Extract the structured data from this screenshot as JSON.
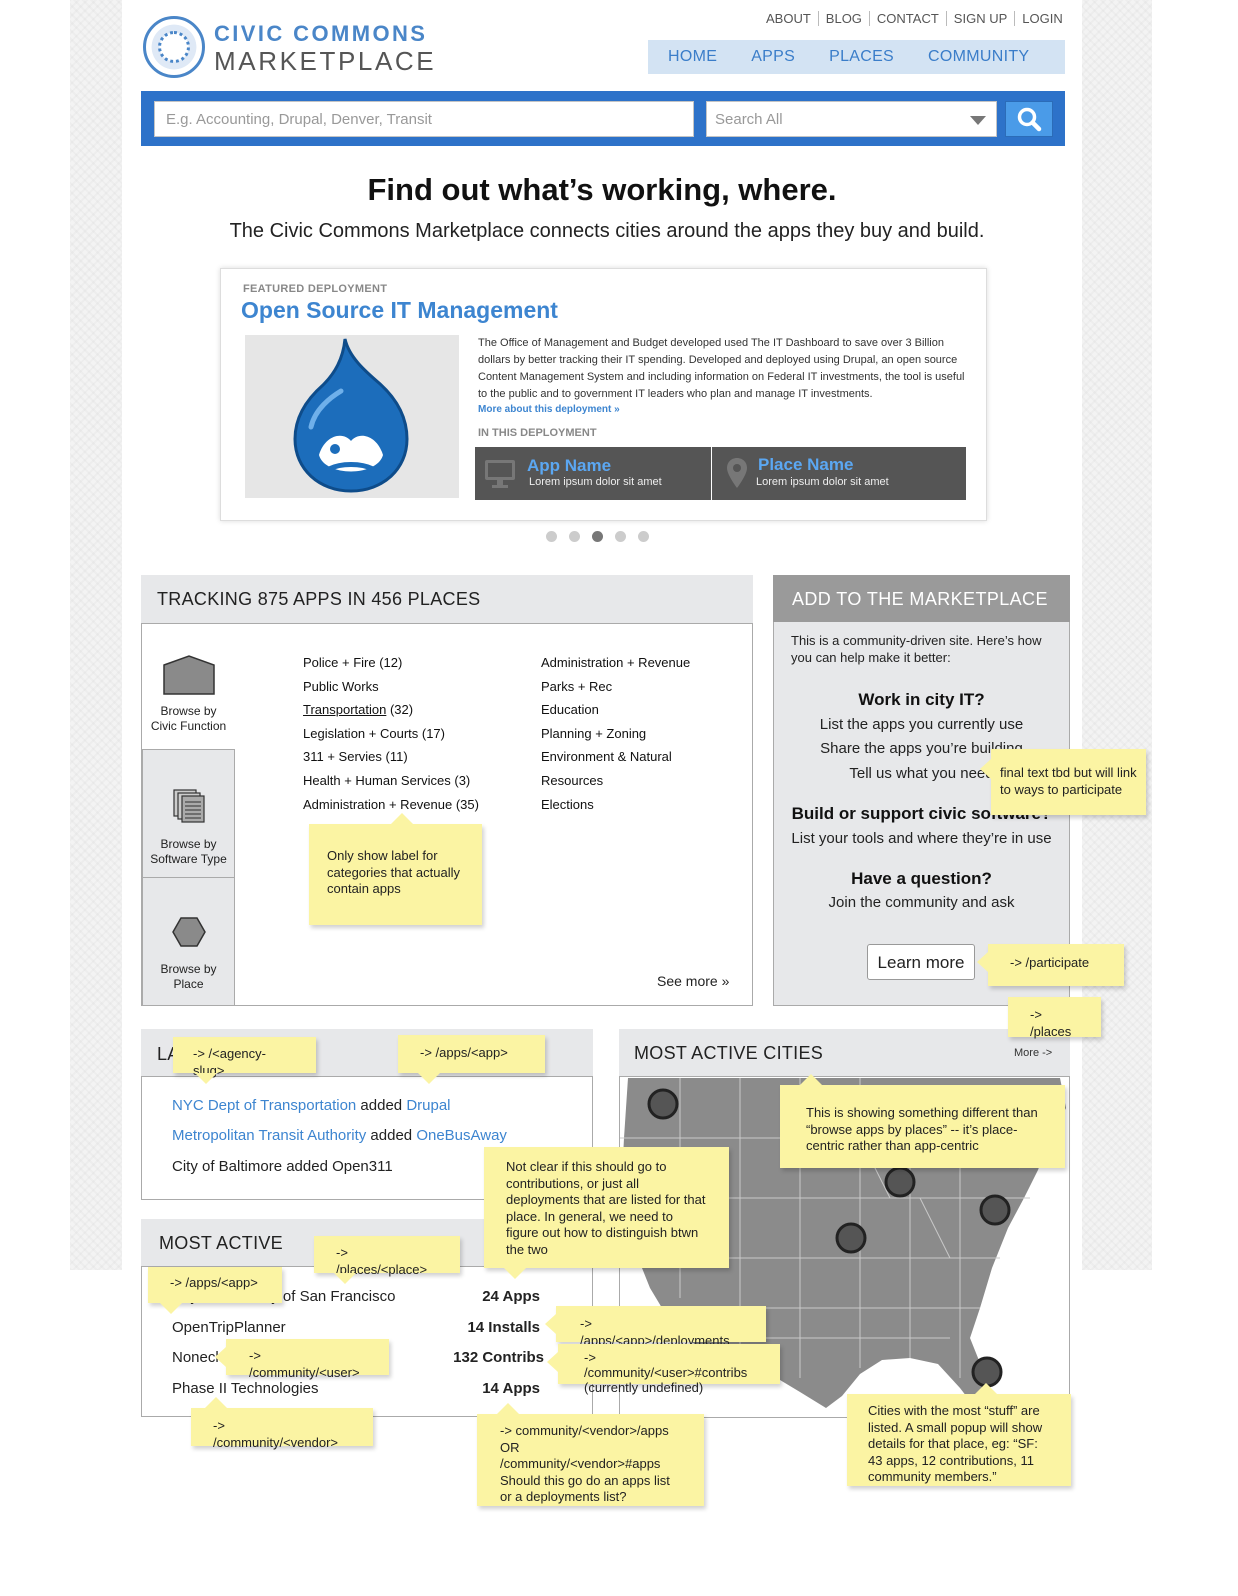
{
  "header": {
    "logo_top": "CIVIC COMMONS",
    "logo_bottom": "MARKETPLACE",
    "util_links": [
      "ABOUT",
      "BLOG",
      "CONTACT",
      "SIGN UP",
      "LOGIN"
    ],
    "nav": [
      "HOME",
      "APPS",
      "PLACES",
      "COMMUNITY"
    ]
  },
  "search": {
    "placeholder": "E.g. Accounting, Drupal, Denver, Transit",
    "scope": "Search All"
  },
  "hero": {
    "title": "Find out what’s working, where.",
    "subtitle": "The Civic Commons Marketplace connects cities around the apps they buy and build."
  },
  "featured": {
    "label": "FEATURED DEPLOYMENT",
    "title": "Open Source IT Management",
    "description": "The Office of Management and Budget developed used The IT Dashboard to save over 3 Billion dollars by better tracking their IT spending. Developed and deployed using Drupal, an open source Content Management System and including information on Federal IT investments, the tool is useful to the public and to government IT leaders who plan and manage IT investments.",
    "more_link": "More about this deployment »",
    "in_label": "IN THIS DEPLOYMENT",
    "app": {
      "title": "App Name",
      "sub": "Lorem ipsum dolor sit amet"
    },
    "place": {
      "title": "Place Name",
      "sub": "Lorem ipsum dolor sit amet"
    },
    "carousel_active": 3,
    "carousel_count": 5
  },
  "tracking": {
    "title": "TRACKING 875 APPS IN 456 PLACES",
    "tabs": [
      {
        "label1": "Browse by",
        "label2": "Civic Function"
      },
      {
        "label1": "Browse by",
        "label2": "Software Type"
      },
      {
        "label1": "Browse by",
        "label2": "Place"
      }
    ],
    "col1": [
      "Police + Fire (12)",
      "Public Works",
      "Transportation (32)",
      "Legislation + Courts (17)",
      "311 + Servies (11)",
      "Health + Human Services (3)",
      "Administration + Revenue (35)"
    ],
    "col2": [
      "Administration + Revenue",
      "Parks + Rec",
      "Education",
      "Planning + Zoning",
      "Environment & Natural",
      "Resources",
      "Elections"
    ],
    "see_more": "See more »"
  },
  "add": {
    "title": "ADD  TO THE MARKETPLACE",
    "intro1": "This is a community-driven site.  Here’s how",
    "intro2": "you can help make it better:",
    "h1": "Work in city IT?",
    "l1": "List the apps you currently use",
    "l2": "Share the apps you’re building",
    "l3": "Tell us what you need",
    "h2": "Build or support civic software?",
    "l4": "List your tools and where they’re in use",
    "h3": "Have a question?",
    "l5": "Join the community and ask",
    "button": "Learn more"
  },
  "latest": {
    "title": "LATEST ACTIVITY",
    "items": [
      {
        "actor": "NYC Dept of Transportation",
        "verb": " added ",
        "object": "Drupal"
      },
      {
        "actor": "Metropolitan Transit Authority",
        "verb": " added ",
        "object": "OneBusAway"
      },
      {
        "plain": "City of Baltimore added Open311"
      }
    ]
  },
  "most_active": {
    "title": "MOST ACTIVE",
    "rows": [
      {
        "name": "City  and County of San Francisco",
        "count": "24 Apps"
      },
      {
        "name": "OpenTripPlanner",
        "count": "14 Installs"
      },
      {
        "name": "Noneck",
        "count": "132 Contribs"
      },
      {
        "name": "Phase II Technologies",
        "count": "14 Apps"
      }
    ]
  },
  "cities": {
    "title": "MOST ACTIVE CITIES",
    "more": "More ->"
  },
  "notes": {
    "n_show_label": "Only show label for categories that actually contain apps",
    "n_final": "final text tbd but will link to ways to participate",
    "n_participate": "-> /participate",
    "n_places": "-> /places",
    "n_agency": "-> /<agency-slug>",
    "n_apps_app": "-> /apps/<app>",
    "n_place_centric": "This is showing something different than “browse apps by places” -- it’s place-centric rather than app-centric",
    "n_contrib": "Not clear if this should go to contributions, or just all deployments that are listed for that place. In general, we need to figure out how to distinguish btwn the two",
    "n_places_place": "-> /places/<place>",
    "n_apps_app2": "-> /apps/<app>",
    "n_deployments": "-> /apps/<app>/deployments",
    "n_community_user": "-> /community/<user>",
    "n_contribs": "-> /community/<user>#contribs (currently undefined)",
    "n_vendor": "-> /community/<vendor>",
    "n_vendor_apps": "-> community/<vendor>/apps OR /community/<vendor>#apps Should this go do an apps list or a deployments list?",
    "n_cities": "Cities with the most “stuff” are listed.  A small popup will show details for that place, eg: “SF: 43 apps, 12 contributions, 11 community members.”"
  }
}
